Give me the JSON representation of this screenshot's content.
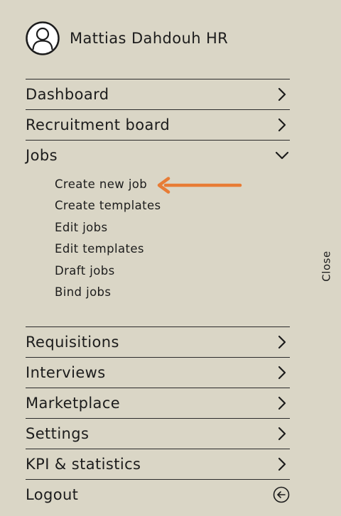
{
  "user": {
    "name": "Mattias Dahdouh HR"
  },
  "menu": {
    "dashboard": "Dashboard",
    "recruitment_board": "Recruitment board",
    "jobs": "Jobs",
    "requisitions": "Requisitions",
    "interviews": "Interviews",
    "marketplace": "Marketplace",
    "settings": "Settings",
    "kpi": "KPI & statistics",
    "logout": "Logout"
  },
  "jobs_submenu": {
    "create_new_job": "Create new job",
    "create_templates": "Create templates",
    "edit_jobs": "Edit jobs",
    "edit_templates": "Edit templates",
    "draft_jobs": "Draft jobs",
    "bind_jobs": "Bind jobs"
  },
  "close_label": "Close",
  "colors": {
    "background": "#dad6c6",
    "text": "#1c1c1c",
    "divider": "#2a2a2a",
    "annotation_arrow": "#e87c35"
  },
  "icons": {
    "avatar": "user-circle",
    "collapsed": "chevron-right",
    "expanded": "chevron-down",
    "logout": "circle-arrow-left"
  }
}
